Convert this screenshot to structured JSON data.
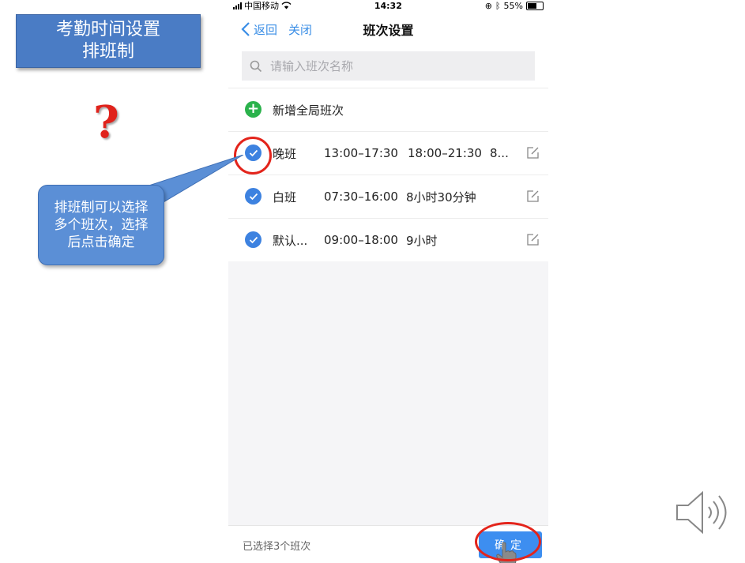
{
  "slide": {
    "title_line1": "考勤时间设置",
    "title_line2": "排班制",
    "question_mark": "?",
    "callout_line1": "排班制可以选择",
    "callout_line2": "多个班次，选择",
    "callout_line3": "后点击确定"
  },
  "statusbar": {
    "carrier": "中国移动",
    "time": "14:32",
    "battery": "55%"
  },
  "navbar": {
    "back_label": "返回",
    "close_label": "关闭",
    "title": "班次设置"
  },
  "search": {
    "placeholder": "请输入班次名称"
  },
  "add_shift_label": "新增全局班次",
  "shifts": [
    {
      "name": "晚班",
      "period1": "13:00–17:30",
      "period2": "18:00–21:30",
      "extra": "8...",
      "checked": true
    },
    {
      "name": "白班",
      "period1": "07:30–16:00",
      "period2": "8小时30分钟",
      "extra": "",
      "checked": true
    },
    {
      "name": "默认...",
      "period1": "09:00–18:00",
      "period2": "9小时",
      "extra": "",
      "checked": true
    }
  ],
  "footer": {
    "selected_count": "已选择3个班次",
    "confirm_label": "确定"
  },
  "colors": {
    "accent": "#3d82e0",
    "add_green": "#2bb24c",
    "annotation_red": "#e3241b",
    "title_box_blue": "#4a7cc5"
  },
  "icons": [
    "back-chevron-icon",
    "search-icon",
    "plus-circle-icon",
    "check-circle-icon",
    "edit-icon",
    "speaker-icon",
    "hand-cursor-icon"
  ]
}
